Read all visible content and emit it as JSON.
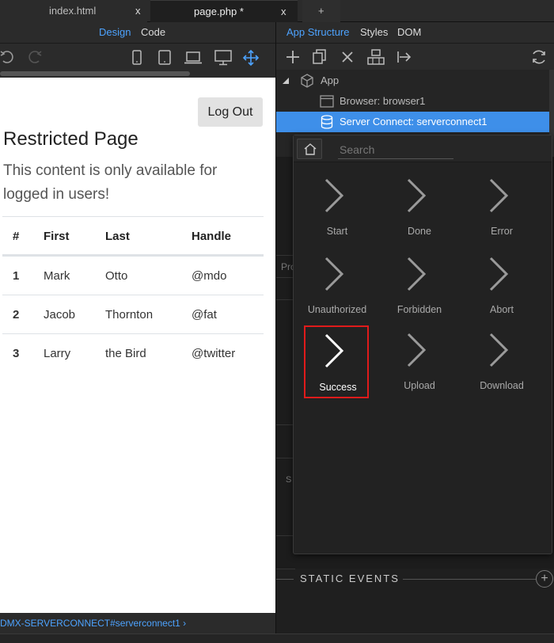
{
  "tabs": [
    {
      "label": "index.html",
      "close": "x"
    },
    {
      "label": "page.php *",
      "close": "x"
    },
    {
      "label": "+"
    }
  ],
  "left": {
    "modes": [
      "Design",
      "Code"
    ],
    "icons": [
      "undo-icon",
      "redo-icon",
      "phone-icon",
      "tablet-icon",
      "laptop-icon",
      "desktop-icon",
      "move-icon"
    ]
  },
  "canvas": {
    "logout_label": "Log Out",
    "title": "Restricted Page",
    "lead": "This content is only available for logged in users!",
    "table": {
      "headers": [
        "#",
        "First",
        "Last",
        "Handle"
      ],
      "rows": [
        [
          "1",
          "Mark",
          "Otto",
          "@mdo"
        ],
        [
          "2",
          "Jacob",
          "Thornton",
          "@fat"
        ],
        [
          "3",
          "Larry",
          "the Bird",
          "@twitter"
        ]
      ]
    }
  },
  "statusbar": {
    "path": "DMX-SERVERCONNECT#serverconnect1 ›"
  },
  "right": {
    "tabs": [
      "App Structure",
      "Styles",
      "DOM"
    ],
    "tree": [
      {
        "label": "App",
        "icon": "cube-icon"
      },
      {
        "label": "Browser: browser1",
        "icon": "browser-icon"
      },
      {
        "label": "Server Connect: serverconnect1",
        "icon": "database-icon"
      }
    ],
    "static_events_label": "STATIC EVENTS"
  },
  "popup": {
    "search_placeholder": "Search",
    "events": [
      {
        "label": "Start"
      },
      {
        "label": "Done"
      },
      {
        "label": "Error"
      },
      {
        "label": "Unauthorized"
      },
      {
        "label": "Forbidden"
      },
      {
        "label": "Abort"
      },
      {
        "label": "Success"
      },
      {
        "label": "Upload"
      },
      {
        "label": "Download"
      }
    ],
    "highlighted_event": "Success",
    "highlight_color": "#e01b1b"
  },
  "colors": {
    "accent": "#4da3ff",
    "selection": "#3e8fe9"
  }
}
